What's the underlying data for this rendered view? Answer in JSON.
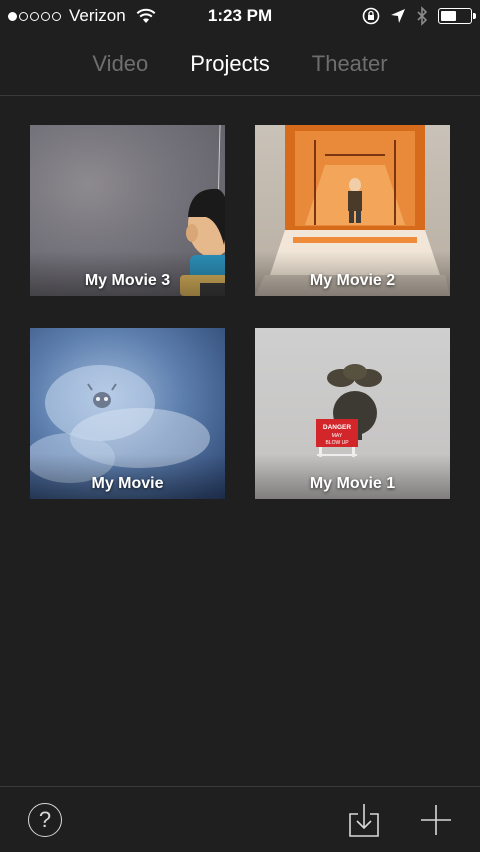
{
  "status_bar": {
    "carrier": "Verizon",
    "time": "1:23 PM",
    "signal_bars_filled": 1,
    "signal_bars_total": 5
  },
  "nav": {
    "tabs": [
      {
        "label": "Video",
        "active": false
      },
      {
        "label": "Projects",
        "active": true
      },
      {
        "label": "Theater",
        "active": false
      }
    ]
  },
  "projects": [
    {
      "title": "My Movie 3"
    },
    {
      "title": "My Movie 2"
    },
    {
      "title": "My Movie"
    },
    {
      "title": "My Movie 1"
    }
  ],
  "sign_text": [
    "DANGER",
    "MAY",
    "BLOW UP"
  ],
  "toolbar": {
    "help_label": "?",
    "icons": [
      "help-icon",
      "import-icon",
      "add-icon"
    ]
  },
  "colors": {
    "background": "#1f1f1f",
    "inactive_tab": "#6e6e6e",
    "active_tab": "#ffffff",
    "divider": "#3a3a3a"
  }
}
